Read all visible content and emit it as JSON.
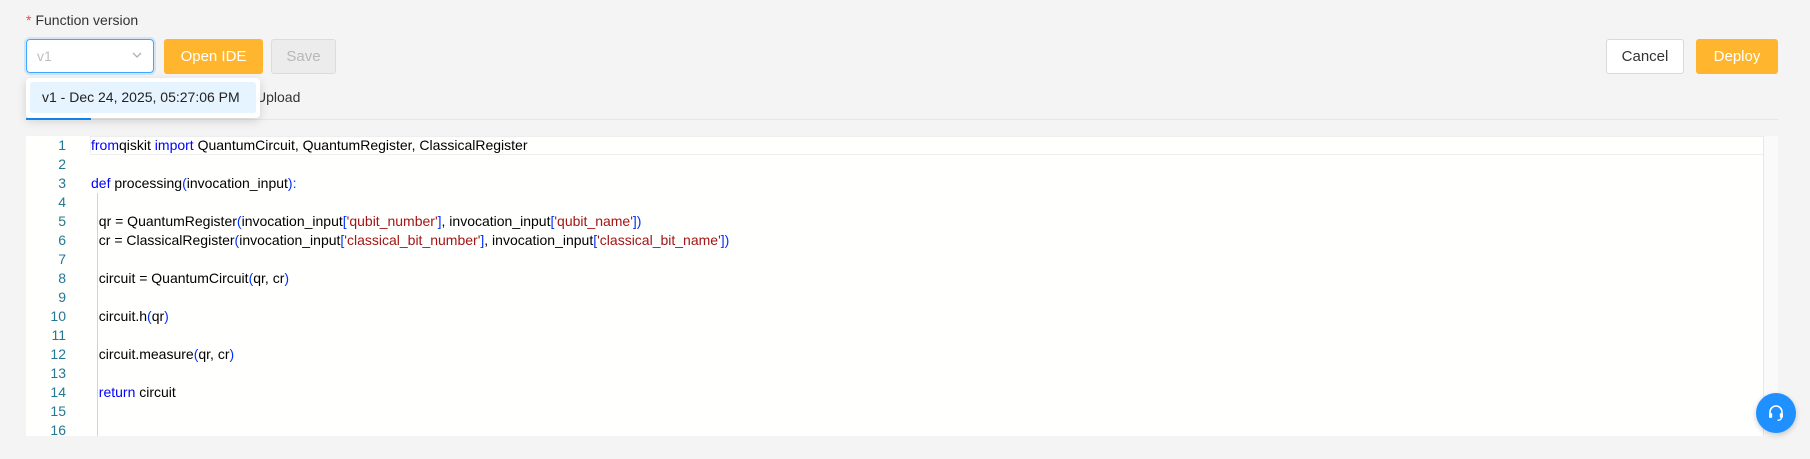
{
  "form": {
    "required_mark": "*",
    "label": "Function version"
  },
  "version_select": {
    "value": "v1",
    "icon": "chevron-down-icon"
  },
  "toolbar": {
    "open_ide_label": "Open IDE",
    "save_label": "Save",
    "cancel_label": "Cancel",
    "deploy_label": "Deploy"
  },
  "tabs": {
    "upload_label": "Upload"
  },
  "dropdown": {
    "options": [
      {
        "label": "v1  -  Dec 24, 2025, 05:27:06 PM"
      }
    ]
  },
  "editor": {
    "lines": [
      {
        "n": "1",
        "tokens": [
          [
            "kw",
            "from"
          ],
          [
            "",
            "qiskit "
          ],
          [
            "kw",
            "import"
          ],
          [
            "",
            " QuantumCircuit, QuantumRegister, ClassicalRegister"
          ]
        ]
      },
      {
        "n": "2",
        "tokens": []
      },
      {
        "n": "3",
        "tokens": [
          [
            "kw",
            "def"
          ],
          [
            "",
            " processing"
          ],
          [
            "br",
            "("
          ],
          [
            "",
            "invocation_input"
          ],
          [
            "br",
            "):"
          ]
        ]
      },
      {
        "n": "4",
        "tokens": []
      },
      {
        "n": "5",
        "tokens": [
          [
            "",
            "  qr = QuantumRegister"
          ],
          [
            "br",
            "("
          ],
          [
            "",
            "invocation_input"
          ],
          [
            "br",
            "["
          ],
          [
            "str",
            "'qubit_number'"
          ],
          [
            "br",
            "]"
          ],
          [
            "",
            ", invocation_input"
          ],
          [
            "br",
            "["
          ],
          [
            "str",
            "'qubit_name'"
          ],
          [
            "br",
            "])"
          ]
        ]
      },
      {
        "n": "6",
        "tokens": [
          [
            "",
            "  cr = ClassicalRegister"
          ],
          [
            "br",
            "("
          ],
          [
            "",
            "invocation_input"
          ],
          [
            "br",
            "["
          ],
          [
            "str",
            "'classical_bit_number'"
          ],
          [
            "br",
            "]"
          ],
          [
            "",
            ", invocation_input"
          ],
          [
            "br",
            "["
          ],
          [
            "str",
            "'classical_bit_name'"
          ],
          [
            "br",
            "])"
          ]
        ]
      },
      {
        "n": "7",
        "tokens": []
      },
      {
        "n": "8",
        "tokens": [
          [
            "",
            "  circuit = QuantumCircuit"
          ],
          [
            "br",
            "("
          ],
          [
            "",
            "qr, cr"
          ],
          [
            "br",
            ")"
          ]
        ]
      },
      {
        "n": "9",
        "tokens": []
      },
      {
        "n": "10",
        "tokens": [
          [
            "",
            "  circuit.h"
          ],
          [
            "br",
            "("
          ],
          [
            "",
            "qr"
          ],
          [
            "br",
            ")"
          ]
        ]
      },
      {
        "n": "11",
        "tokens": []
      },
      {
        "n": "12",
        "tokens": [
          [
            "",
            "  circuit.measure"
          ],
          [
            "br",
            "("
          ],
          [
            "",
            "qr, cr"
          ],
          [
            "br",
            ")"
          ]
        ]
      },
      {
        "n": "13",
        "tokens": []
      },
      {
        "n": "14",
        "tokens": [
          [
            "",
            "  "
          ],
          [
            "kw",
            "return"
          ],
          [
            "",
            " circuit"
          ]
        ]
      },
      {
        "n": "15",
        "tokens": []
      },
      {
        "n": "16",
        "tokens": []
      }
    ]
  },
  "help_button": {
    "icon": "headset-icon"
  },
  "colors": {
    "accent": "#ffb62e",
    "primary": "#1890ff",
    "keyword": "#0000ff",
    "string": "#a31515",
    "bracket": "#0431fa",
    "line_number": "#237893"
  }
}
